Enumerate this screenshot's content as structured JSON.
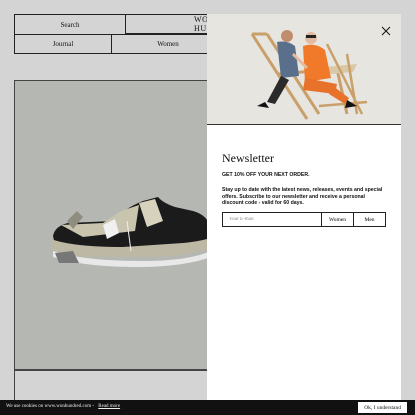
{
  "header": {
    "search_label": "Search",
    "logo_text": "WON HU",
    "journal_label": "Journal",
    "women_label": "Women"
  },
  "newsletter": {
    "title": "Newsletter",
    "offer": "GET 10% OFF YOUR NEXT ORDER.",
    "description": "Stay up to date with the latest news, releases, events and special offers. Subscribe to our newsletter and receive a personal discount code - valid for 60 days.",
    "email_placeholder": "Your E-mail",
    "women_button": "Women",
    "men_button": "Men",
    "close_icon": "close-icon"
  },
  "cookie_bar": {
    "text": "We use cookies on www.wonhundred.com -",
    "link": "Read more",
    "button": "Ok, I understand"
  },
  "colors": {
    "page_bg": "#d4d4d4",
    "product_bg": "#b5b7b3",
    "cookie_bg": "#111111",
    "modal_bg": "#ffffff",
    "orange_suit": "#f07a2a"
  }
}
